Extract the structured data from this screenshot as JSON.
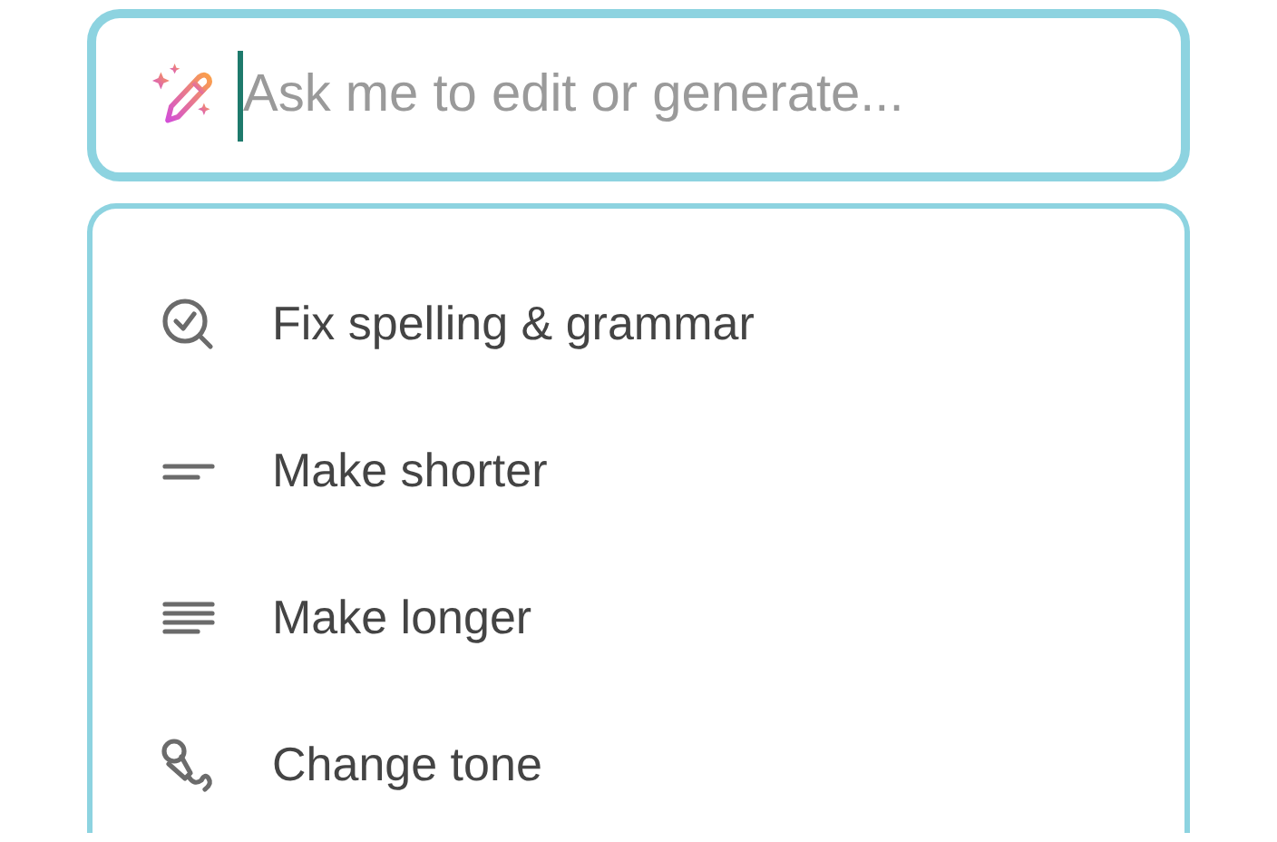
{
  "prompt": {
    "placeholder": "Ask me to edit or generate..."
  },
  "actions": [
    {
      "kind": "check",
      "label": "Fix spelling & grammar"
    },
    {
      "kind": "shorter",
      "label": "Make shorter"
    },
    {
      "kind": "longer",
      "label": "Make longer"
    },
    {
      "kind": "tone",
      "label": "Change tone"
    }
  ]
}
